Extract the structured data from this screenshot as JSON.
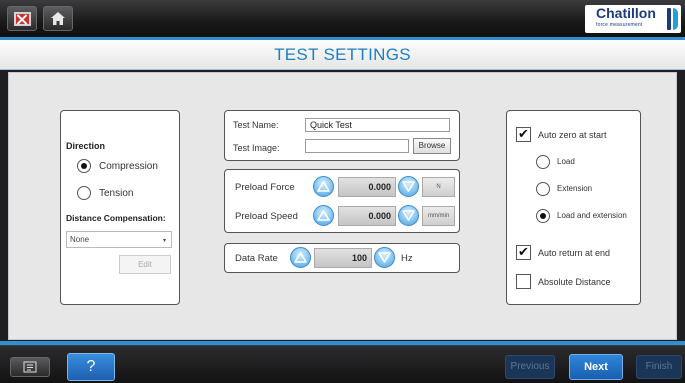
{
  "header": {
    "exit_icon": "exit-icon",
    "home_icon": "home-icon",
    "brand": {
      "name": "Chatillon",
      "tagline": "force measurement"
    }
  },
  "page_title": "TEST SETTINGS",
  "direction": {
    "label": "Direction",
    "options": [
      {
        "label": "Compression",
        "selected": true
      },
      {
        "label": "Tension",
        "selected": false
      }
    ],
    "distance_compensation_label": "Distance Compensation:",
    "distance_compensation_value": "None",
    "edit_label": "Edit"
  },
  "test": {
    "name_label": "Test Name:",
    "name_value": "Quick Test",
    "image_label": "Test Image:",
    "image_value": "",
    "browse_label": "Browse"
  },
  "preload": {
    "force_label": "Preload Force",
    "force_value": "0.000",
    "force_unit": "N",
    "speed_label": "Preload Speed",
    "speed_value": "0.000",
    "speed_unit": "mm/min"
  },
  "data_rate": {
    "label": "Data Rate",
    "value": "100",
    "unit": "Hz"
  },
  "options": {
    "auto_zero_label": "Auto zero at start",
    "auto_zero_checked": true,
    "zero_modes": [
      {
        "label": "Load",
        "selected": false
      },
      {
        "label": "Extension",
        "selected": false
      },
      {
        "label": "Load and extension",
        "selected": true
      }
    ],
    "auto_return_label": "Auto return at end",
    "auto_return_checked": true,
    "absolute_distance_label": "Absolute Distance",
    "absolute_distance_checked": false
  },
  "footer": {
    "list_icon": "list-icon",
    "help_label": "?",
    "previous_label": "Previous",
    "next_label": "Next",
    "finish_label": "Finish"
  },
  "colors": {
    "accent": "#2f8fd0",
    "title": "#1d7fc1",
    "brand_navy": "#1d3b7a",
    "next_button": "#1f6fc4"
  },
  "check_mark": "✔"
}
